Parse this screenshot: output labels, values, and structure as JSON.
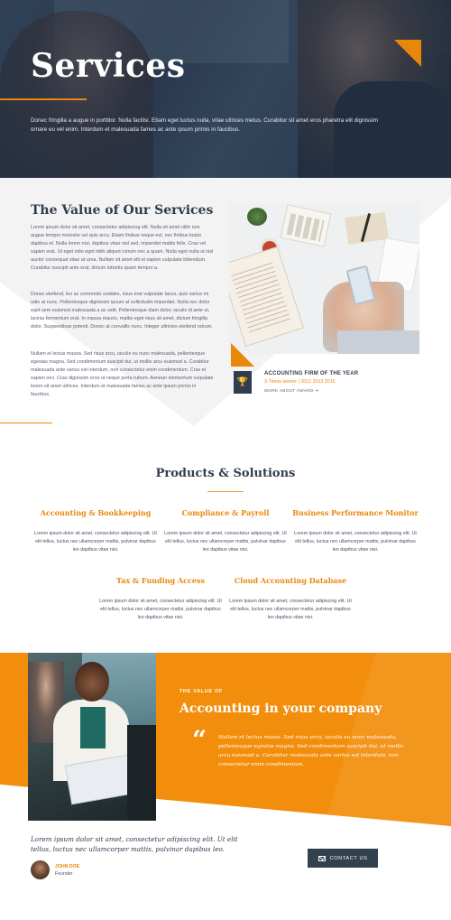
{
  "hero": {
    "title": "Services",
    "text": "Donec fringilla a augue in porttitor. Nulla facilisi. Etiam eget luctus nulla, vitae ultrices metus. Curabitur sit amet eros pharetra elit dignissim ornare eu vel enim. Interdum et malesuada fames ac ante ipsum primis in faucibus."
  },
  "value": {
    "title": "The Value of Our Services",
    "paragraphs": [
      "Lorem ipsum dolor sit amet, consectetur adipiscing elit. Nulla sit amet nibh non augue tempor molestie vel quis arcu. Etiam finibus neque est, nec finibus turpis dapibus et. Nulla lorem nisl, dapibus vitae nisl sed, imperdiet mattis felis. Cras vel sapien erat. Ut eget odio eget nibh aliquet rutrum nec a quam. Nulla eget nulla ut nisl auctor consequat vitae at urna. Nullam sit amet elit et sapien vulputate bibendum. Curabitur suscipit ante erat, dictum lobortis quam tempor a.",
      "Donec eleifend, leo ac commodo sodales, risus erat vulputate lacus, quis varius mi odio at nunc. Pellentesque dignissim ipsum at sollicitudin imperdiet. Nulla nec dolor eget sem euismod malesuada a ac velit. Pellentesque diam dolor, iaculis id ante ut, lacinia fermentum erat. In massa mauris, mattis eget risus sit amet, dictum fringilla dolor. Suspendisse potenti. Donec at convallis nunc. Integer ultricies eleifend rutrum.",
      "Nullam et lectus massa. Sed risus arcu, iaculis eu nunc malesuada, pellentesque egestas magna. Sed condimentum suscipit dui, ut mollis arcu euismod a. Curabitur malesuada ante varius est interdum, non consectetur enim condimentum. Cras et sapien orci. Cras dignissim eros ut neque porta rutrum. Aenean elementum vulputate lorem sit amet ultrices. Interdum et malesuada fames ac ante ipsum primis in faucibus."
    ],
    "award": {
      "title": "ACCOUNTING FIRM OF THE YEAR",
      "sub": "3-Times winner | 2012 2013 2016",
      "link": "MORE ABOUT AWARD ➔"
    }
  },
  "products": {
    "title": "Products & Solutions",
    "items": [
      {
        "title": "Accounting & Bookkeeping",
        "text": "Lorem ipsum dolor sit amet, consectetur adipiscing elit. Ut elit tellus, luctus nec ullamcorper mattis, pulvinar dapibus leo dapibus vitae nisi."
      },
      {
        "title": "Compliance & Payroll",
        "text": "Lorem ipsum dolor sit amet, consectetur adipiscing elit. Ut elit tellus, luctus nec ullamcorper mattis, pulvinar dapibus leo dapibus vitae nisi."
      },
      {
        "title": "Business Performance Monitor",
        "text": "Lorem ipsum dolor sit amet, consectetur adipiscing elit. Ut elit tellus, luctus nec ullamcorper mattis, pulvinar dapibus leo dapibus vitae nisi."
      },
      {
        "title": "Tax & Funding Access",
        "text": "Lorem ipsum dolor sit amet, consectetur adipiscing elit. Ut elit tellus, luctus nec ullamcorper mattis, pulvinar dapibus leo dapibus vitae nisi."
      },
      {
        "title": "Cloud Accounting Database",
        "text": "Lorem ipsum dolor sit amet, consectetur adipiscing elit. Ut elit tellus, luctus nec ullamcorper mattis, pulvinar dapibus leo dapibus vitae nisi."
      }
    ]
  },
  "band": {
    "kicker": "THE VALUE OF",
    "title": "Accounting in your company",
    "quote_mark": "“",
    "quote": "Nullam et lectus massa. Sed risus arcu, iaculis eu nunc malesuada, pellentesque egestas magna. Sed condimentum suscipit dui, ut mollis arcu euismod a. Curabitur malesuada ante varius est interdum, non consectetur enim condimentum."
  },
  "testimonial": {
    "text": "Lorem ipsum dolor sit amet, consectetur adipiscing elit. Ut elit tellus, luctus nec ullamcorper mattis, pulvinar dapibus leo.",
    "name": "JOHN DOE",
    "role": "Founder"
  },
  "contact_button": "CONTACT US",
  "icons": {
    "award": "trophy-icon",
    "quote": "quote-icon",
    "mail": "mail-icon"
  },
  "colors": {
    "accent": "#e9870b",
    "band": "#f28e0c",
    "dark": "#2f3d4f"
  }
}
